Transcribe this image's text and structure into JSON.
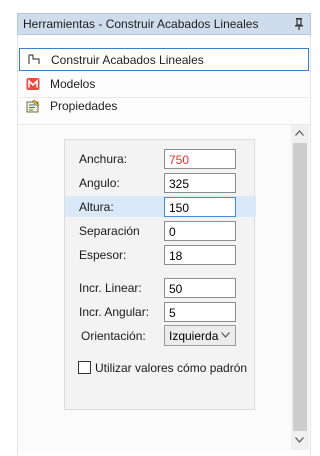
{
  "window": {
    "title": "Herramientas - Construir Acabados Lineales"
  },
  "nav": {
    "items": [
      {
        "label": "Construir Acabados Lineales",
        "icon": "linear-finish-icon",
        "active": true
      },
      {
        "label": "Modelos",
        "icon": "models-m-icon",
        "active": false
      },
      {
        "label": "Propiedades",
        "icon": "properties-icon",
        "active": false
      }
    ]
  },
  "form": {
    "fields": [
      {
        "label": "Anchura:",
        "value": "750"
      },
      {
        "label": "Angulo:",
        "value": "325"
      },
      {
        "label": "Altura:",
        "value": "150"
      },
      {
        "label": "Separación",
        "value": "0"
      },
      {
        "label": "Espesor:",
        "value": "18"
      },
      {
        "label": "Incr. Linear:",
        "value": "50"
      },
      {
        "label": "Incr. Angular:",
        "value": "5"
      }
    ],
    "orientation": {
      "label": "Orientación:",
      "value": "Izquierda"
    },
    "default_checkbox": {
      "label": "Utilizar valores cómo padrón",
      "checked": false
    }
  },
  "colors": {
    "accent": "#3b7ec9",
    "highlight_row": "#d9e9f8",
    "warn_value": "#e03030"
  }
}
